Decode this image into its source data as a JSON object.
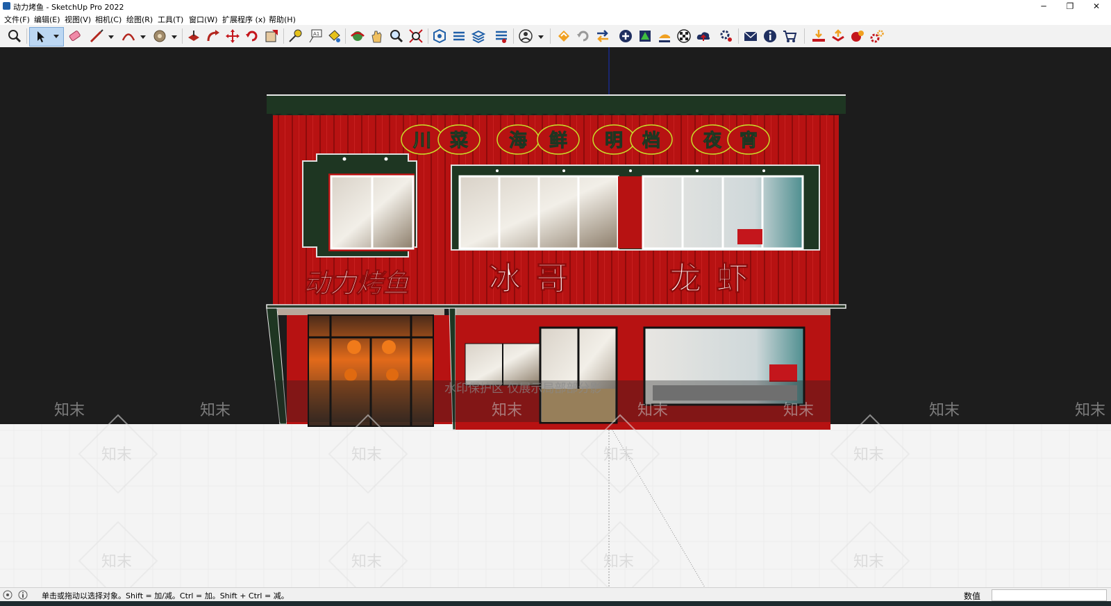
{
  "window": {
    "title": "动力烤鱼 - SketchUp Pro 2022",
    "min_glyph": "─",
    "restore_glyph": "❐",
    "close_glyph": "✕"
  },
  "menu": [
    "文件(F)",
    "编辑(E)",
    "视图(V)",
    "相机(C)",
    "绘图(R)",
    "工具(T)",
    "窗口(W)",
    "扩展程序 (x)",
    "帮助(H)"
  ],
  "model": {
    "top_sign_chars": [
      "川",
      "菜",
      "海",
      "鲜",
      "明",
      "档",
      "夜",
      "宵"
    ],
    "shop_sign_1": "动力烤鱼",
    "shop_sign_2": "冰哥",
    "shop_sign_3": "龙虾"
  },
  "watermark": {
    "text": "知末",
    "notice": "水印保护区  仅展示局部部分影"
  },
  "status": {
    "message": "单击或拖动以选择对象。Shift = 加/减。Ctrl = 加。Shift + Ctrl = 减。",
    "measure_label": "数值",
    "measure_value": ""
  },
  "colors": {
    "facade_red": "#b71212",
    "sign_green": "#1e3622",
    "sky": "#1c1c1c",
    "sign_yellow": "#c9df2a",
    "toolbar_bg": "#f2f2f2"
  }
}
